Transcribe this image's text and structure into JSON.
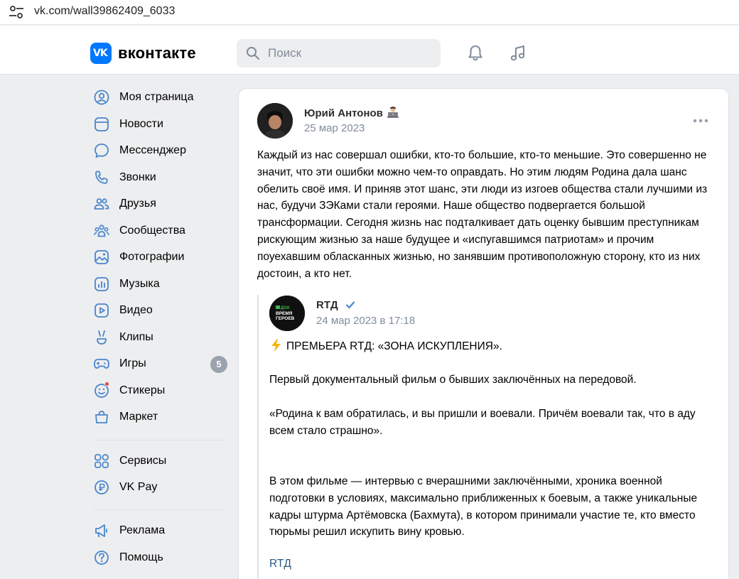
{
  "browser": {
    "url": "vk.com/wall39862409_6033"
  },
  "header": {
    "logo_mark": "VK",
    "wordmark": "вконтакте",
    "search_placeholder": "Поиск"
  },
  "nav": {
    "items": [
      {
        "label": "Моя страница",
        "icon": "profile-icon"
      },
      {
        "label": "Новости",
        "icon": "news-icon"
      },
      {
        "label": "Мессенджер",
        "icon": "messenger-icon"
      },
      {
        "label": "Звонки",
        "icon": "phone-icon"
      },
      {
        "label": "Друзья",
        "icon": "friends-icon"
      },
      {
        "label": "Сообщества",
        "icon": "communities-icon"
      },
      {
        "label": "Фотографии",
        "icon": "photos-icon"
      },
      {
        "label": "Музыка",
        "icon": "music-icon"
      },
      {
        "label": "Видео",
        "icon": "video-icon"
      },
      {
        "label": "Клипы",
        "icon": "clips-icon"
      },
      {
        "label": "Игры",
        "icon": "games-icon",
        "badge": "5"
      },
      {
        "label": "Стикеры",
        "icon": "stickers-icon"
      },
      {
        "label": "Маркет",
        "icon": "market-icon"
      },
      {
        "label": "Сервисы",
        "icon": "services-icon"
      },
      {
        "label": "VK Pay",
        "icon": "vkpay-icon"
      },
      {
        "label": "Реклама",
        "icon": "ads-icon"
      },
      {
        "label": "Помощь",
        "icon": "help-icon"
      }
    ]
  },
  "post": {
    "author": "Юрий Антонов",
    "date": "25 мар 2023",
    "text": "Каждый из нас совершал ошибки, кто-то большие, кто-то меньшие. Это совершенно не значит, что эти ошибки можно чем-то оправдать. Но этим людям Родина дала шанс обелить своё имя. И приняв этот шанс, эти люди из изгоев общества стали лучшими из нас, будучи ЗЭКами стали героями. Наше общество подвергается большой трансформации. Сегодня жизнь нас подталкивает дать оценку бывшим преступникам рискующим жизнью за наше будущее и «испугавшимся патриотам» и прочим поуехавшим обласканных жизнью, но занявшим противоположную сторону, кто из них достоин, а кто нет.",
    "repost": {
      "author": "RTД",
      "avatar_text_1": "ДОК",
      "avatar_text_2": "ВРЕМЯ",
      "avatar_text_3": "ГЕРОЕВ",
      "date": "24 мар 2023 в 17:18",
      "line1": "ПРЕМЬЕРА RTД: «ЗОНА ИСКУПЛЕНИЯ».",
      "line2": "Первый документальный фильм о бывших заключённых на передовой.",
      "line3": "«Родина к вам обратилась, и вы пришли и воевали. Причём воевали так, что в аду всем стало страшно».",
      "line4": "В этом фильме — интервью с вчерашними заключёнными, хроника военной подготовки в условиях, максимально приближенных к боевым, а также уникальные кадры штурма Артёмовска (Бахмута), в котором принимали участие те, кто вместо тюрьмы решил искупить вину кровью.",
      "link": "RTД"
    }
  },
  "colors": {
    "accent": "#0077ff",
    "link": "#2a5885",
    "secondary_text": "#818c99",
    "page_bg": "#edeef0"
  }
}
